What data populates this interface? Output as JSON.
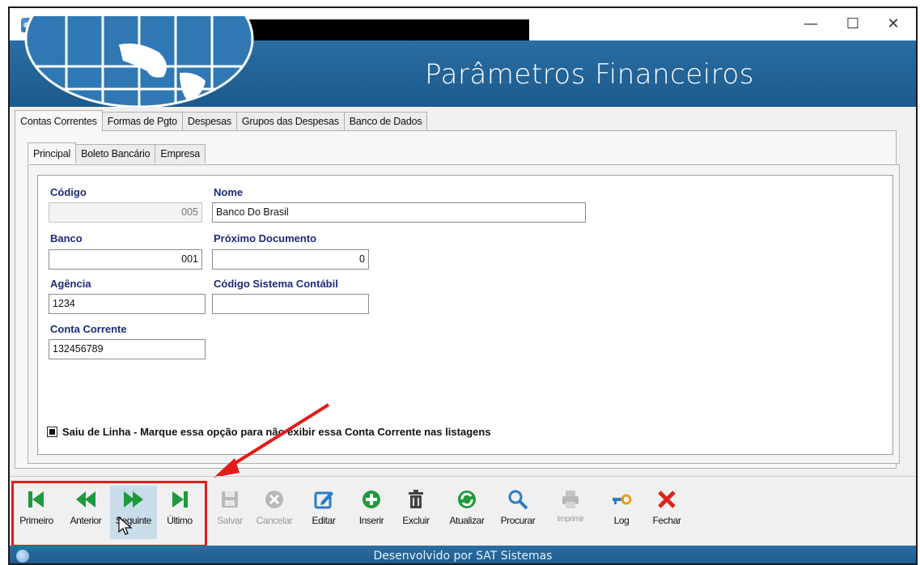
{
  "window": {
    "title": "",
    "controls": {
      "minimize": "—",
      "maximize": "☐",
      "close": "✕"
    }
  },
  "header": {
    "title": "Parâmetros Financeiros"
  },
  "tabs": [
    "Contas Correntes",
    "Formas de Pgto",
    "Despesas",
    "Grupos das Despesas",
    "Banco de Dados"
  ],
  "subtabs": [
    "Principal",
    "Boleto Bancário",
    "Empresa"
  ],
  "form": {
    "codigo": {
      "label": "Código",
      "value": "005"
    },
    "nome": {
      "label": "Nome",
      "value": "Banco Do Brasil"
    },
    "banco": {
      "label": "Banco",
      "value": "001"
    },
    "proximo_documento": {
      "label": "Próximo Documento",
      "value": "0"
    },
    "agencia": {
      "label": "Agência",
      "value": "1234"
    },
    "codigo_sistema_contabil": {
      "label": "Código Sistema Contábil",
      "value": ""
    },
    "conta_corrente": {
      "label": "Conta Corrente",
      "value": "132456789"
    },
    "saiu_de_linha": {
      "label": "Saiu de Linha - Marque essa opção para não exibir essa Conta Corrente nas listagens",
      "checked": true
    }
  },
  "toolbar": {
    "primeiro": "Primeiro",
    "anterior": "Anterior",
    "seguinte": "Seguinte",
    "ultimo": "Último",
    "salvar": "Salvar",
    "cancelar": "Cancelar",
    "editar": "Editar",
    "inserir": "Inserir",
    "excluir": "Excluir",
    "atualizar": "Atualizar",
    "procurar": "Procurar",
    "imprimir": "Imprimir",
    "log": "Log",
    "fechar": "Fechar"
  },
  "icons": {
    "first": "skip-first-icon",
    "prev": "rewind-icon",
    "next": "fast-forward-icon",
    "last": "skip-last-icon",
    "save": "save-icon",
    "cancel": "cancel-icon",
    "edit": "edit-icon",
    "insert": "plus-circle-icon",
    "delete": "trash-icon",
    "refresh": "refresh-icon",
    "search": "search-icon",
    "print": "printer-icon",
    "log": "key-icon",
    "close": "close-x-icon"
  },
  "colors": {
    "brand_blue": "#1d5a8c",
    "nav_green": "#1e9a3c",
    "label_blue": "#1c2a7a",
    "highlight_red": "#e21b1b",
    "close_red": "#d9261c"
  },
  "statusbar": {
    "text": "Desenvolvido por SAT Sistemas"
  }
}
